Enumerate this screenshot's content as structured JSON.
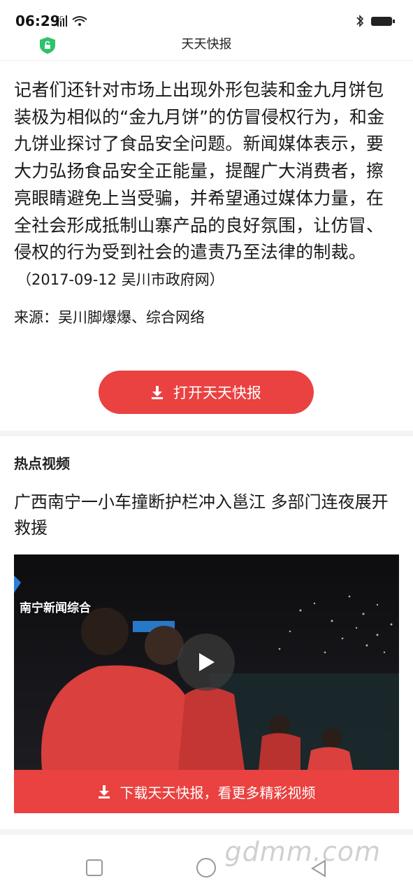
{
  "status_bar": {
    "time": "06:29",
    "network": "4G"
  },
  "app": {
    "title": "天天快报"
  },
  "article": {
    "body": "记者们还针对市场上出现外形包装和金九月饼包装极为相似的“金九月饼”的仿冒侵权行为，和金九饼业探讨了食品安全问题。新闻媒体表示，要大力弘扬食品安全正能量，提醒广大消费者，擦亮眼睛避免上当受骗，并希望通过媒体力量，在全社会形成抵制山寨产品的良好氛围，让仿冒、侵权的行为受到社会的遣责乃至法律的制裁。",
    "dateline": "（2017-09-12 吴川市政府网）",
    "source": "来源：吴川脚爆爆、综合网络"
  },
  "open_button": {
    "label": "打开天天快报"
  },
  "hot_videos": {
    "section_title": "热点视频",
    "video_title": "广西南宁一小车撞断护栏冲入邕江 多部门连夜展开救援",
    "video_overlay_label": "南宁新闻综合",
    "download_bar_label": "下载天天快报，看更多精彩视频"
  },
  "watermark": "gdmm.com",
  "colors": {
    "accent": "#e94240",
    "shield": "#2dc26b"
  }
}
